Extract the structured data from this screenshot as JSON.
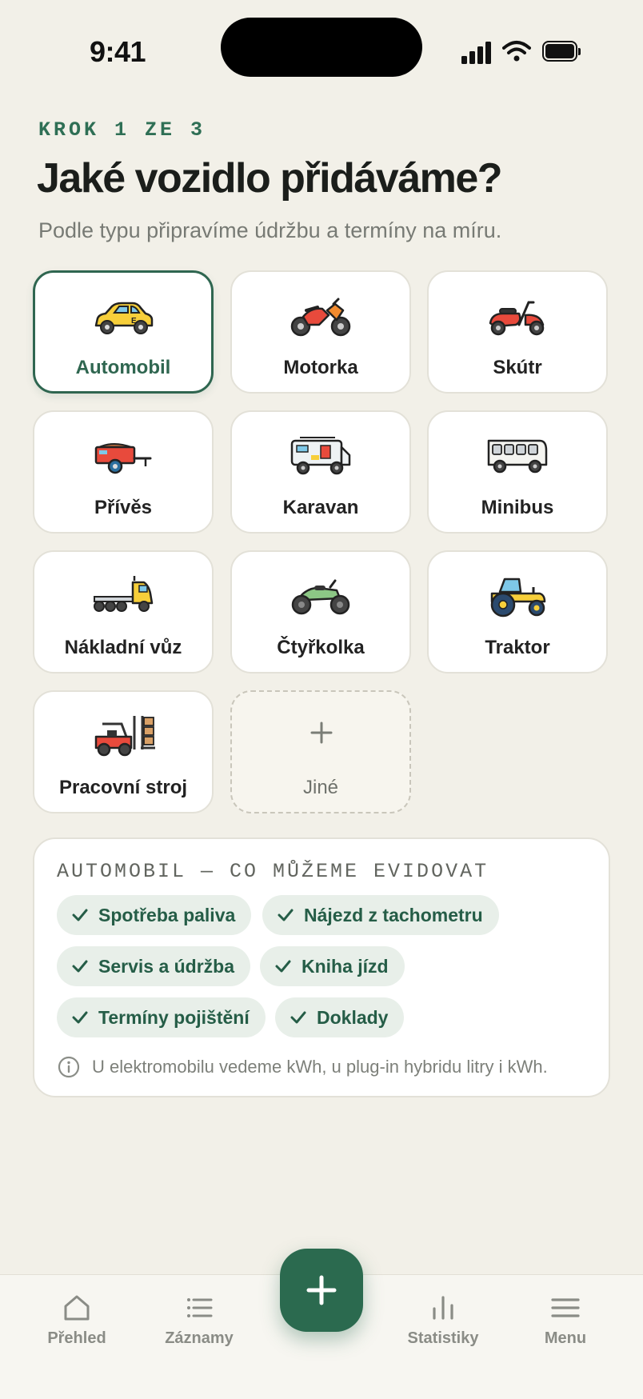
{
  "status": {
    "time": "9:41"
  },
  "header": {
    "step": "KROK 1 ZE 3",
    "title": "Jaké vozidlo přidáváme?",
    "subtitle": "Podle typu připravíme údržbu a termíny na míru."
  },
  "vehicles": [
    {
      "label": "Automobil",
      "icon": "car-icon",
      "selected": true
    },
    {
      "label": "Motorka",
      "icon": "motorcycle-icon"
    },
    {
      "label": "Skútr",
      "icon": "scooter-icon"
    },
    {
      "label": "Přívěs",
      "icon": "trailer-icon"
    },
    {
      "label": "Karavan",
      "icon": "caravan-icon"
    },
    {
      "label": "Minibus",
      "icon": "minibus-icon"
    },
    {
      "label": "Nákladní vůz",
      "icon": "truck-icon"
    },
    {
      "label": "Čtyřkolka",
      "icon": "atv-icon"
    },
    {
      "label": "Traktor",
      "icon": "tractor-icon"
    },
    {
      "label": "Pracovní stroj",
      "icon": "forklift-icon"
    },
    {
      "label": "Jiné",
      "icon": "plus-icon"
    }
  ],
  "info": {
    "heading": "AUTOMOBIL — CO MŮŽEME EVIDOVAT",
    "chips": [
      "Spotřeba paliva",
      "Nájezd z tachometru",
      "Servis a údržba",
      "Kniha jízd",
      "Termíny pojištění",
      "Doklady"
    ],
    "note": "U elektromobilu vedeme kWh, u plug-in hybridu litry i kWh."
  },
  "tabbar": {
    "items": [
      {
        "label": "Přehled",
        "icon": "home-icon"
      },
      {
        "label": "Záznamy",
        "icon": "list-icon"
      },
      {
        "label": "Statistiky",
        "icon": "bar-chart-icon"
      },
      {
        "label": "Menu",
        "icon": "menu-icon"
      }
    ],
    "fab_icon": "plus-icon"
  },
  "colors": {
    "accent": "#2b6a4f",
    "background": "#f2f0e8",
    "chip_bg": "#e8efe9"
  }
}
